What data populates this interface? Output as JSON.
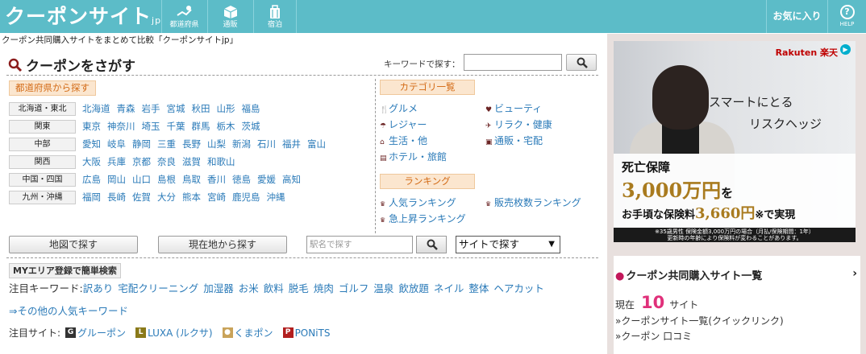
{
  "header": {
    "logo": "クーポンサイト",
    "logo_suffix": "jp",
    "nav": [
      {
        "label": "都道府県",
        "icon": "map-pin-icon"
      },
      {
        "label": "通販",
        "icon": "box-icon"
      },
      {
        "label": "宿泊",
        "icon": "luggage-icon"
      }
    ],
    "favorites": "お気に入り",
    "help": "HELP",
    "help_symbol": "?"
  },
  "tagline": "クーポン共同購入サイトをまとめて比較「クーポンサイトjp」",
  "search": {
    "title": "クーポンをさがす",
    "keyword_label": "キーワードで探す：",
    "keyword_value": ""
  },
  "prefecture": {
    "heading": "都道府県から探す",
    "regions": [
      {
        "name": "北海道・東北",
        "prefs": [
          "北海道",
          "青森",
          "岩手",
          "宮城",
          "秋田",
          "山形",
          "福島"
        ]
      },
      {
        "name": "関東",
        "prefs": [
          "東京",
          "神奈川",
          "埼玉",
          "千葉",
          "群馬",
          "栃木",
          "茨城"
        ]
      },
      {
        "name": "中部",
        "prefs": [
          "愛知",
          "岐阜",
          "静岡",
          "三重",
          "長野",
          "山梨",
          "新潟",
          "石川",
          "福井",
          "富山"
        ]
      },
      {
        "name": "関西",
        "prefs": [
          "大阪",
          "兵庫",
          "京都",
          "奈良",
          "滋賀",
          "和歌山"
        ]
      },
      {
        "name": "中国・四国",
        "prefs": [
          "広島",
          "岡山",
          "山口",
          "島根",
          "鳥取",
          "香川",
          "徳島",
          "愛媛",
          "高知"
        ]
      },
      {
        "name": "九州・沖縄",
        "prefs": [
          "福岡",
          "長崎",
          "佐賀",
          "大分",
          "熊本",
          "宮崎",
          "鹿児島",
          "沖縄"
        ]
      }
    ]
  },
  "category": {
    "heading": "カテゴリ一覧",
    "items": [
      {
        "glyph": "🍴",
        "label": "グルメ"
      },
      {
        "glyph": "♥",
        "label": "ビューティ"
      },
      {
        "glyph": "☂",
        "label": "レジャー"
      },
      {
        "glyph": "✈",
        "label": "リラク・健康"
      },
      {
        "glyph": "⌂",
        "label": "生活・他"
      },
      {
        "glyph": "▣",
        "label": "通販・宅配"
      },
      {
        "glyph": "▤",
        "label": "ホテル・旅館"
      }
    ]
  },
  "ranking": {
    "heading": "ランキング",
    "items": [
      {
        "glyph": "♛",
        "label": "人気ランキング"
      },
      {
        "glyph": "♛",
        "label": "販売枚数ランキング"
      },
      {
        "glyph": "♛",
        "label": "急上昇ランキング"
      }
    ]
  },
  "tools": {
    "map_search": "地図で探す",
    "location_search": "現在地から探す",
    "station_placeholder": "駅名で探す",
    "site_select": "サイトで探す",
    "select_arrow": "▼"
  },
  "my_area": "MYエリア登録で簡単検索",
  "keywords": {
    "label": "注目キーワード:",
    "items": [
      "訳あり",
      "宅配クリーニング",
      "加湿器",
      "お米",
      "飲料",
      "脱毛",
      "焼肉",
      "ゴルフ",
      "温泉",
      "飲放題",
      "ネイル",
      "整体",
      "ヘアカット"
    ],
    "more": "⇒その他の人気キーワード"
  },
  "featured_sites": {
    "label": "注目サイト:",
    "items": [
      {
        "badge": "G",
        "label": "グルーポン",
        "color": "#333333"
      },
      {
        "badge": "L",
        "label": "LUXA (ルクサ)",
        "color": "#8a7a1a"
      },
      {
        "badge": "●",
        "label": "くまポン",
        "color": "#c9a35a"
      },
      {
        "badge": "P",
        "label": "PONiTS",
        "color": "#b21f1f"
      }
    ]
  },
  "ad": {
    "brand": "Rakuten 楽天",
    "ad_icon": "▶",
    "tagline1": "スマートにとる",
    "tagline2": "リスクヘッジ",
    "line1": "死亡保障",
    "line2_amount": "3,000万円",
    "line2_suffix": "を",
    "line3_prefix": "お手頃な保険料",
    "line3_amount": "3,660円",
    "line3_suffix": "※で実現",
    "note1": "※35歳男性 保険金額3,000万円の場合（月払/保険期間：1年）",
    "note2": "更新時の年齢により保険料が変わることがあります。"
  },
  "site_list": {
    "heading": "クーポン共同購入サイト一覧",
    "dot": "●",
    "chevron": "›",
    "count_prefix": "現在",
    "count": "10",
    "count_suffix": "サイト",
    "links": [
      "»クーポンサイト一覧(クイックリンク)",
      "»クーポン 口コミ"
    ]
  },
  "colors": {
    "header_bg": "#5cbcc8",
    "link": "#2a7ab8",
    "accent_orange": "#d36b16",
    "count_pink": "#e0307a"
  }
}
